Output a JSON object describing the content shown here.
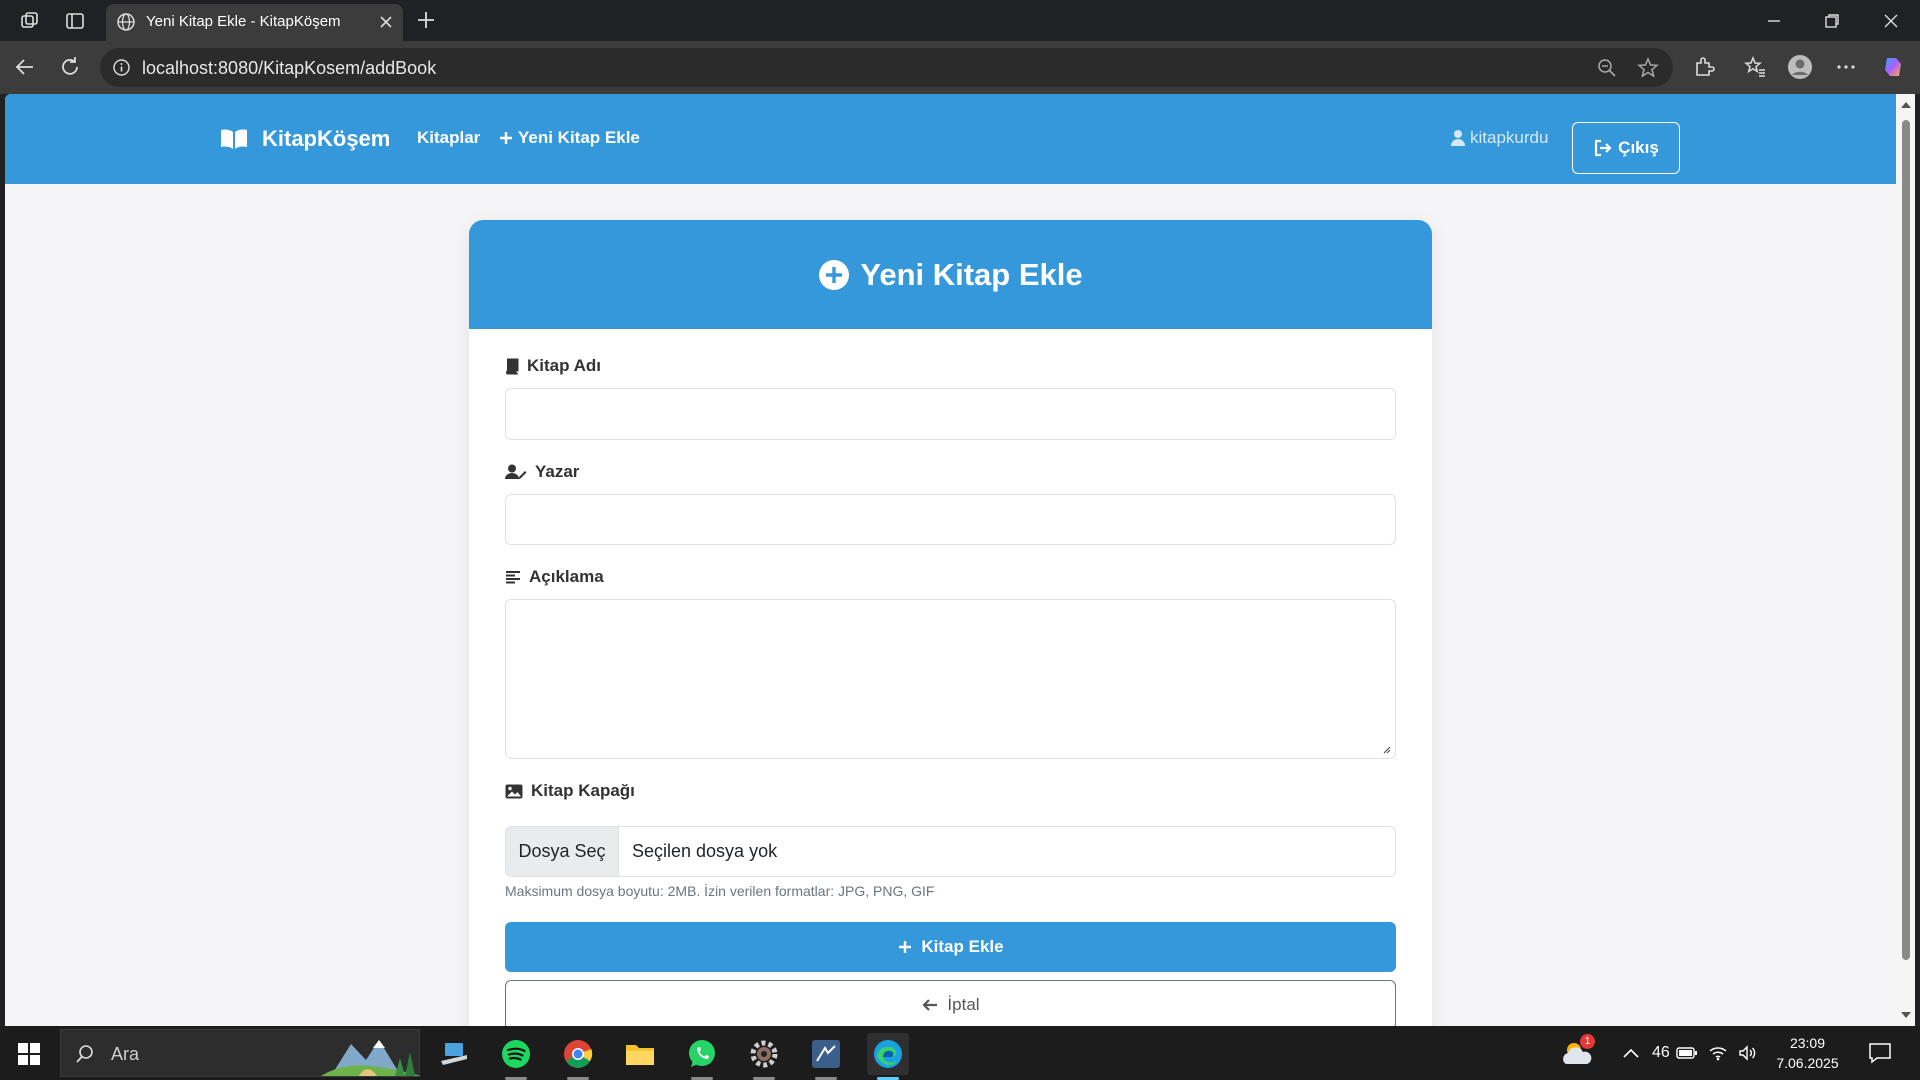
{
  "browser": {
    "tab_title": "Yeni Kitap Ekle - KitapKöşem",
    "url": "localhost:8080/KitapKosem/addBook"
  },
  "navbar": {
    "brand": "KitapKöşem",
    "links": [
      "Kitaplar",
      "Yeni Kitap Ekle"
    ],
    "username": "kitapkurdu",
    "logout_label": "Çıkış"
  },
  "form": {
    "title": "Yeni Kitap Ekle",
    "fields": {
      "title_label": "Kitap Adı",
      "title_value": "",
      "author_label": "Yazar",
      "author_value": "",
      "description_label": "Açıklama",
      "description_value": "",
      "cover_label": "Kitap Kapağı",
      "file_button": "Dosya Seç",
      "file_status": "Seçilen dosya yok",
      "hint": "Maksimum dosya boyutu: 2MB. İzin verilen formatlar: JPG, PNG, GIF"
    },
    "submit_label": "Kitap Ekle",
    "cancel_label": "İptal"
  },
  "taskbar": {
    "search_placeholder": "Ara",
    "tray_temp": "46",
    "weather_badge": "1",
    "time": "23:09",
    "date": "7.06.2025"
  },
  "colors": {
    "primary": "#3498db",
    "page_bg": "#f5f5f7",
    "chrome_dark": "#202124"
  }
}
